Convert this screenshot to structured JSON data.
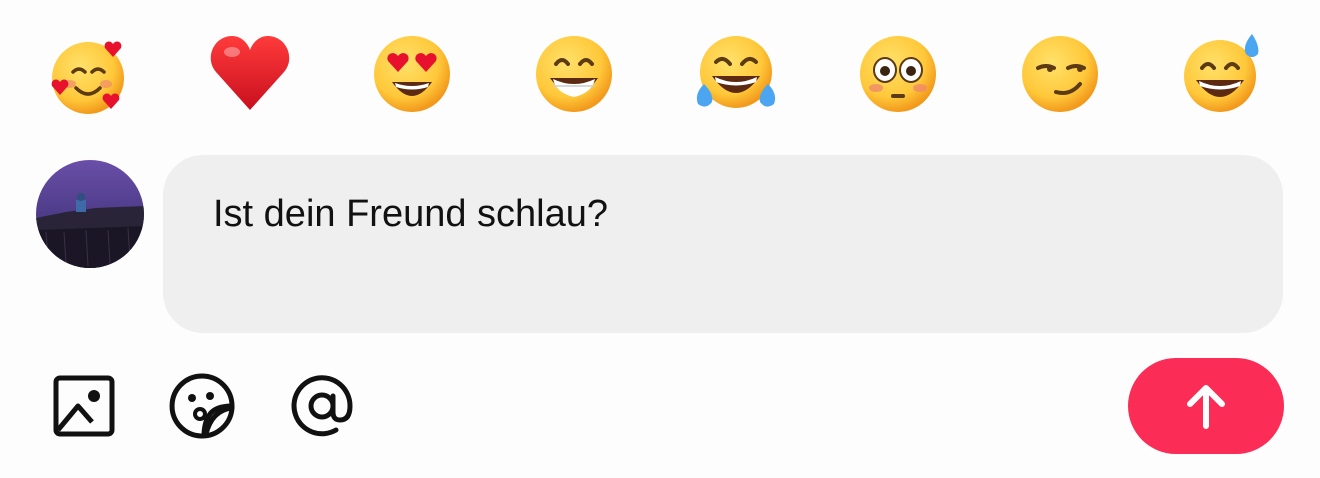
{
  "reactions": [
    {
      "name": "smiling-face-with-hearts-icon"
    },
    {
      "name": "red-heart-icon"
    },
    {
      "name": "heart-eyes-icon"
    },
    {
      "name": "beaming-grin-icon"
    },
    {
      "name": "tears-of-joy-icon"
    },
    {
      "name": "flushed-face-icon"
    },
    {
      "name": "smirking-face-icon"
    },
    {
      "name": "grinning-sweat-icon"
    }
  ],
  "composer": {
    "avatar_icon": "user-avatar",
    "message": "Ist dein Freund schlau?"
  },
  "toolbar": {
    "icons": [
      "image-icon",
      "sticker-icon",
      "mention-icon"
    ],
    "send_icon": "arrow-up-icon",
    "send_color": "#fb2c55"
  },
  "colors": {
    "background": "#fdfdfd",
    "input_background": "#efeff0",
    "emoji_yellow": "#ffc83a"
  }
}
